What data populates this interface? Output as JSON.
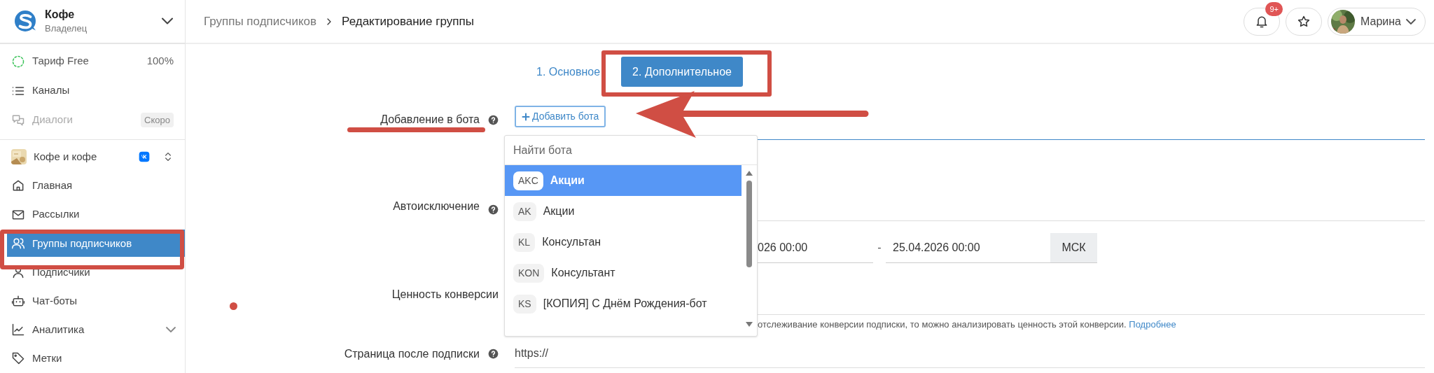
{
  "sidebar": {
    "workspace": {
      "name": "Кофе",
      "role": "Владелец"
    },
    "plan": {
      "label": "Тариф Free",
      "usage": "100%"
    },
    "top_items": [
      {
        "kind": "list",
        "label": "Каналы",
        "disabled": false
      },
      {
        "kind": "chat",
        "label": "Диалоги",
        "disabled": true,
        "badge": "Скоро"
      }
    ],
    "project": {
      "name": "Кофе и кофе"
    },
    "items": [
      {
        "kind": "home",
        "label": "Главная",
        "selected": false,
        "expandable": false
      },
      {
        "kind": "mail",
        "label": "Рассылки",
        "selected": false,
        "expandable": false
      },
      {
        "kind": "users",
        "label": "Группы подписчиков",
        "selected": true,
        "expandable": false
      },
      {
        "kind": "user",
        "label": "Подписчики",
        "selected": false,
        "expandable": false
      },
      {
        "kind": "bot",
        "label": "Чат-боты",
        "selected": false,
        "expandable": false
      },
      {
        "kind": "chart",
        "label": "Аналитика",
        "selected": false,
        "expandable": true
      },
      {
        "kind": "tag",
        "label": "Метки",
        "selected": false,
        "expandable": false
      }
    ]
  },
  "header": {
    "breadcrumb": [
      "Группы подписчиков",
      "Редактирование группы"
    ],
    "notifications_badge": "9+",
    "user": "Марина"
  },
  "tabs": [
    {
      "label": "1. Основное",
      "selected": false
    },
    {
      "label": "2. Дополнительное",
      "selected": true
    }
  ],
  "form": {
    "add_bot": {
      "label": "Добавление в бота",
      "button": "Добавить бота",
      "dropdown": {
        "placeholder": "Найти бота",
        "items": [
          {
            "badge": "AKC",
            "label": "Акции",
            "selected": true
          },
          {
            "badge": "AK",
            "label": "Акции",
            "selected": false
          },
          {
            "badge": "KL",
            "label": "Консультан",
            "selected": false
          },
          {
            "badge": "KON",
            "label": "Консультант",
            "selected": false
          },
          {
            "badge": "KS",
            "label": "[КОПИЯ] С Днём Рождения-бот",
            "selected": false
          }
        ]
      }
    },
    "autoexclusion": {
      "label": "Автоисключение"
    },
    "period": {
      "from": "026 00:00",
      "separator": "-",
      "to": "25.04.2026 00:00",
      "timezone": "МСК"
    },
    "conversion": {
      "label": "Ценность конверсии",
      "hint": "отслеживание конверсии подписки, то можно анализировать ценность этой конверсии.",
      "hint_link": "Подробнее"
    },
    "page": {
      "label": "Страница после подписки",
      "value": "https://"
    }
  }
}
